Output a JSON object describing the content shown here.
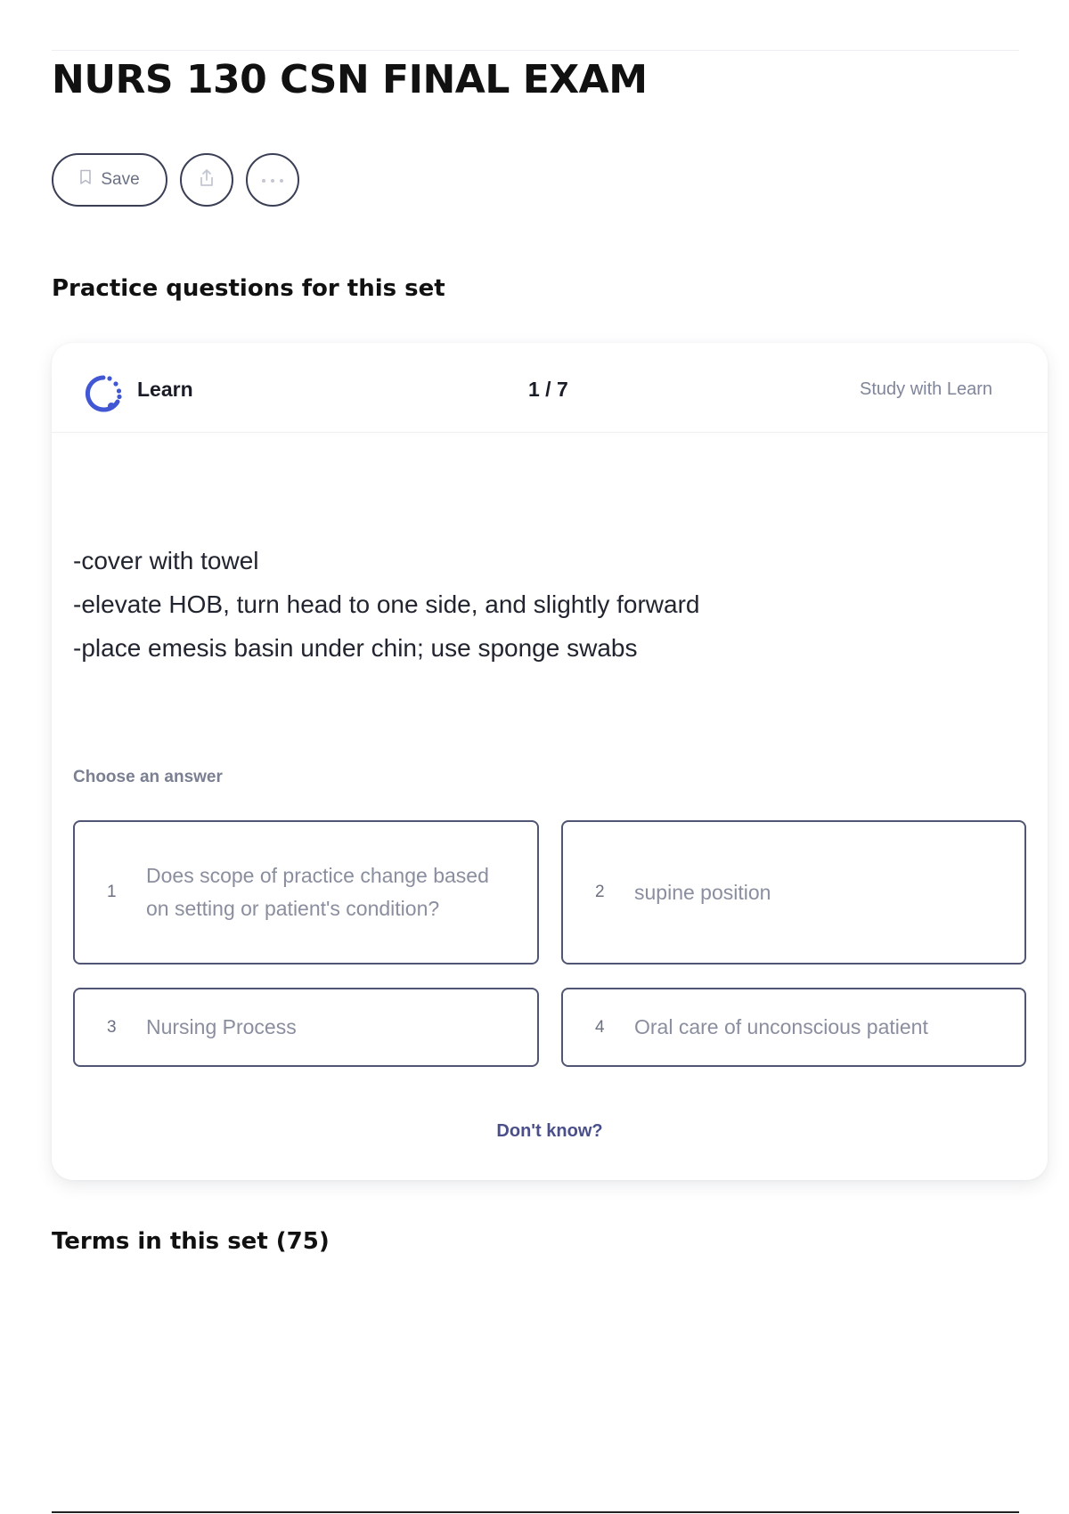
{
  "header": {
    "title": "NURS 130 CSN FINAL EXAM",
    "save_label": "Save"
  },
  "practice": {
    "section_title": "Practice questions for this set",
    "mode_label": "Learn",
    "counter": "1 / 7",
    "study_link": "Study with Learn",
    "prompt_lines": [
      "-cover with towel",
      "-elevate HOB, turn head to one side, and slightly forward",
      "-place emesis basin under chin; use sponge swabs"
    ],
    "choose_label": "Choose an answer",
    "options": [
      {
        "number": "1",
        "text": "Does scope of practice change based on setting or patient's condition?"
      },
      {
        "number": "2",
        "text": "supine position"
      },
      {
        "number": "3",
        "text": "Nursing Process"
      },
      {
        "number": "4",
        "text": "Oral care of unconscious patient"
      }
    ],
    "dont_know": "Don't know?"
  },
  "terms": {
    "section_title": "Terms in this set (75)"
  },
  "colors": {
    "accent_blue": "#4257d4",
    "border": "#505673"
  },
  "icons": {
    "save": "bookmark-icon",
    "share": "share-icon",
    "more": "more-icon",
    "learn": "learn-icon"
  }
}
